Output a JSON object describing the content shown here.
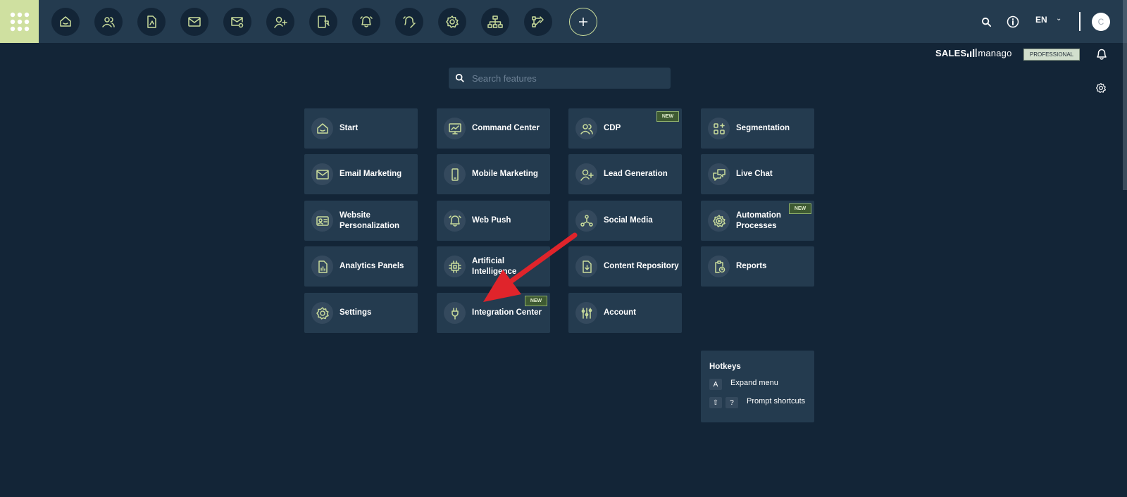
{
  "topbar": {
    "apps_icon": "apps-grid-icon",
    "nav_icons": [
      "home-icon",
      "contacts-icon",
      "document-icon",
      "email-icon",
      "email-settings-icon",
      "add-contact-icon",
      "mobile-icon",
      "bell-icon",
      "bell-wand-icon",
      "gear-icon",
      "sitemap-icon",
      "workflow-icon"
    ],
    "add_icon": "plus-icon",
    "language": "EN",
    "avatar_initial": "C"
  },
  "brand": {
    "name_bold": "SALES",
    "name_light": "manago",
    "plan": "PROFESSIONAL"
  },
  "search": {
    "placeholder": "Search features"
  },
  "tiles": [
    {
      "label": "Start",
      "icon": "home-icon",
      "new": false
    },
    {
      "label": "Command Center",
      "icon": "monitor-chart-icon",
      "new": false
    },
    {
      "label": "CDP",
      "icon": "users-icon",
      "new": true
    },
    {
      "label": "Segmentation",
      "icon": "segments-icon",
      "new": false
    },
    {
      "label": "Email Marketing",
      "icon": "envelope-icon",
      "new": false
    },
    {
      "label": "Mobile Marketing",
      "icon": "smartphone-icon",
      "new": false
    },
    {
      "label": "Lead Generation",
      "icon": "user-plus-icon",
      "new": false
    },
    {
      "label": "Live Chat",
      "icon": "chat-icon",
      "new": false
    },
    {
      "label": "Website Personalization",
      "icon": "id-card-icon",
      "new": false
    },
    {
      "label": "Web Push",
      "icon": "bell-icon",
      "new": false
    },
    {
      "label": "Social Media",
      "icon": "share-nodes-icon",
      "new": false
    },
    {
      "label": "Automation Processes",
      "icon": "gear-play-icon",
      "new": true
    },
    {
      "label": "Analytics Panels",
      "icon": "analytics-file-icon",
      "new": false
    },
    {
      "label": "Artificial Intelligence",
      "icon": "chip-icon",
      "new": false
    },
    {
      "label": "Content Repository",
      "icon": "file-download-icon",
      "new": false
    },
    {
      "label": "Reports",
      "icon": "clipboard-clock-icon",
      "new": false
    },
    {
      "label": "Settings",
      "icon": "gear-icon",
      "new": false
    },
    {
      "label": "Integration Center",
      "icon": "plug-icon",
      "new": true
    },
    {
      "label": "Account",
      "icon": "sliders-icon",
      "new": false
    }
  ],
  "new_badge": "NEW",
  "hotkeys": {
    "title": "Hotkeys",
    "items": [
      {
        "keys": [
          "A"
        ],
        "label": "Expand menu"
      },
      {
        "keys": [
          "⇧",
          "?"
        ],
        "label": "Prompt shortcuts"
      }
    ]
  },
  "colors": {
    "background": "#132537",
    "panel": "#243b4f",
    "accent": "#c9dc9b",
    "arrow": "#e0242b"
  }
}
